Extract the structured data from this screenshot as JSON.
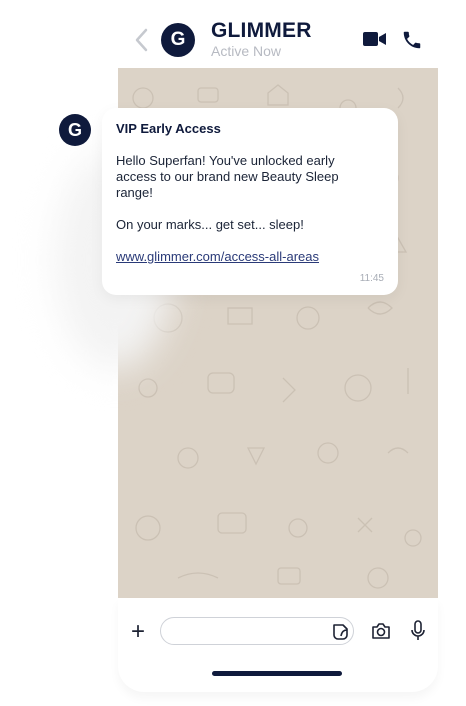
{
  "header": {
    "avatar_letter": "G",
    "name": "GLIMMER",
    "status": "Active Now"
  },
  "message": {
    "avatar_letter": "G",
    "title": "VIP Early Access",
    "line1": "Hello Superfan! You've unlocked early access to our brand new Beauty Sleep range!",
    "line2": "On your marks... get set... sleep!",
    "link": "www.glimmer.com/access-all-areas",
    "time": "11:45"
  },
  "composer": {
    "plus_label": "+",
    "input_value": ""
  },
  "colors": {
    "brand_navy": "#0f1a3c",
    "chat_background": "#dcd3c7",
    "link": "#2a3a78"
  },
  "icons": [
    "back-chevron-icon",
    "video-camera-icon",
    "phone-icon",
    "plus-icon",
    "sticker-icon",
    "camera-icon",
    "microphone-icon"
  ]
}
